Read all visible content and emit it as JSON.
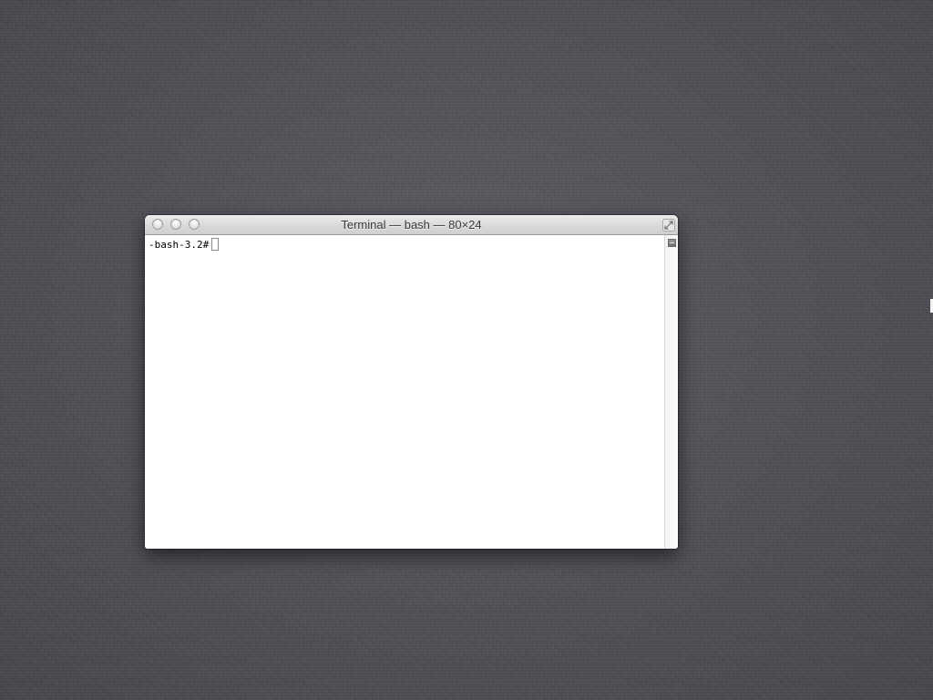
{
  "window": {
    "title": "Terminal — bash — 80×24"
  },
  "terminal": {
    "prompt": "-bash-3.2#",
    "input": ""
  },
  "icons": {
    "close": "close-icon",
    "minimize": "minimize-icon",
    "zoom": "zoom-icon",
    "fullscreen": "fullscreen-icon",
    "split_pane": "split-pane-icon",
    "mouse_cursor": "text-cursor-icon"
  },
  "colors": {
    "desktop_background": "#4f5157",
    "terminal_background": "#ffffff",
    "terminal_text": "#000000"
  }
}
